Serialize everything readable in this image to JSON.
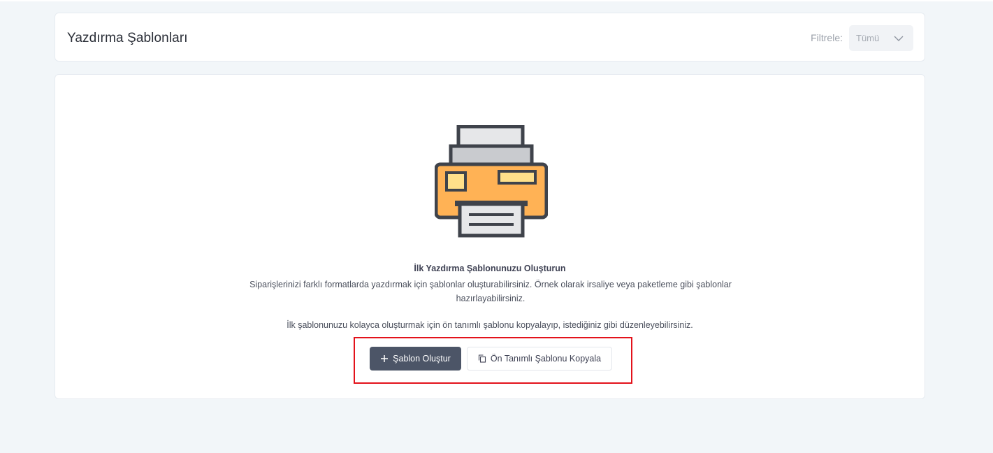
{
  "header": {
    "title": "Yazdırma Şablonları",
    "filter_label": "Filtrele:",
    "filter_value": "Tümü"
  },
  "empty_state": {
    "icon": "printer-icon",
    "title": "İlk Yazdırma Şablonunuzu Oluşturun",
    "description": "Siparişlerinizi farklı formatlarda yazdırmak için şablonlar oluşturabilirsiniz. Örnek olarak irsaliye veya paketleme gibi şablonlar hazırlayabilirsiniz.",
    "hint": "İlk şablonunuzu kolayca oluşturmak için ön tanımlı şablonu kopyalayıp, istediğiniz gibi düzenleyebilirsiniz."
  },
  "actions": {
    "create_label": "Şablon Oluştur",
    "copy_label": "Ön Tanımlı Şablonu Kopyala"
  },
  "colors": {
    "page_background": "#f2f6f9",
    "primary_button": "#4c5567",
    "printer_body": "#ffb255",
    "printer_outline": "#3f434b",
    "highlight": "#e3121b"
  }
}
